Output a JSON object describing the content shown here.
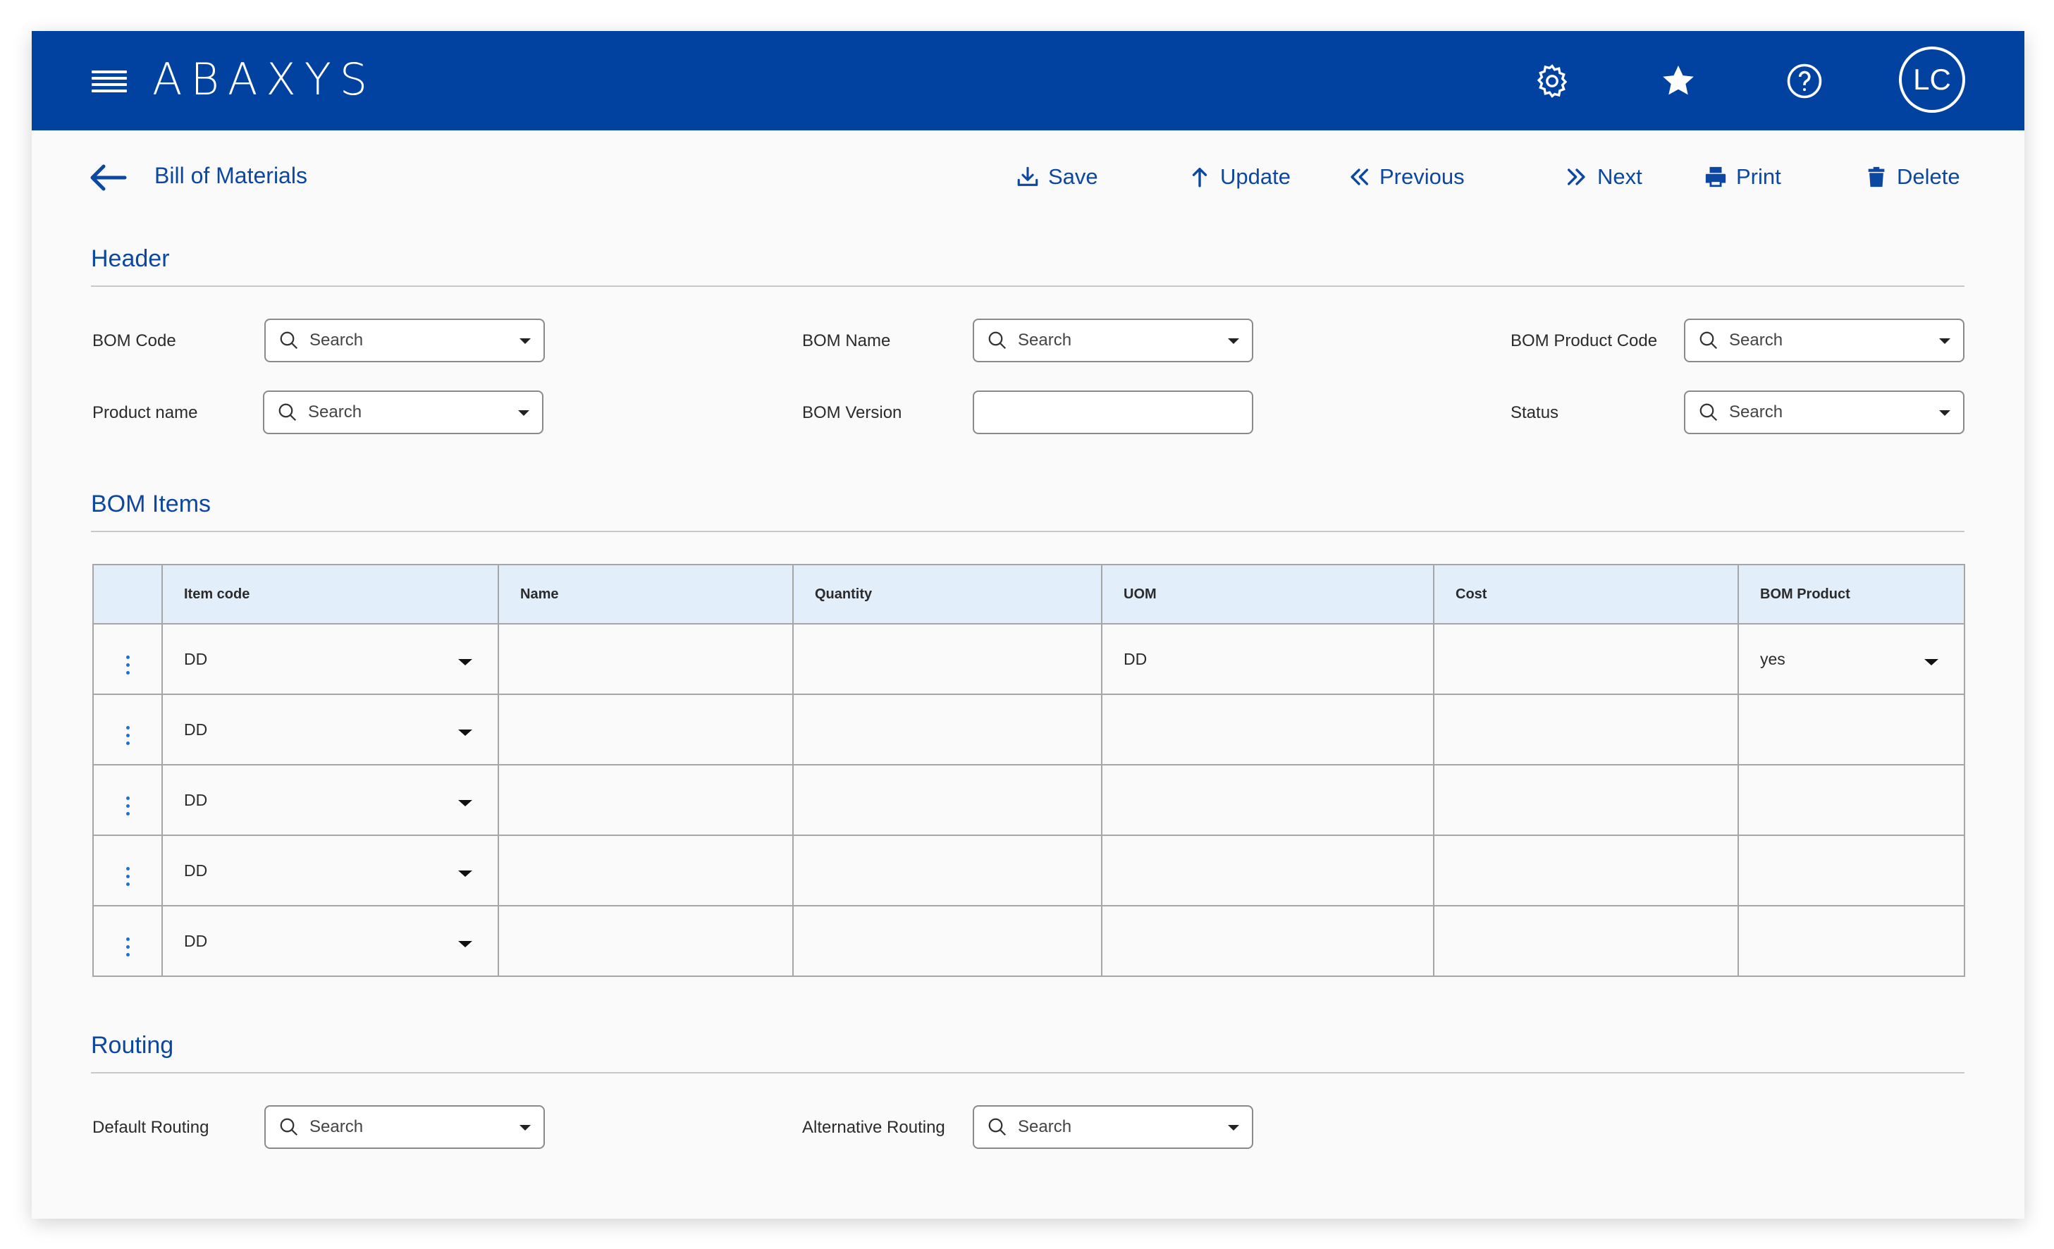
{
  "app": {
    "logo": "ABAXYS",
    "user_initials": "LC"
  },
  "colors": {
    "topbar": "#0141a0",
    "accent_text": "#0c47a1",
    "table_header_bg": "#e3eefb",
    "kebab": "#1f6fd6"
  },
  "icons": {
    "menu": "hamburger-icon",
    "settings": "gear-icon",
    "favorites": "star-icon",
    "help": "help-circle-icon",
    "back": "arrow-left-icon"
  },
  "toolbar": {
    "page_title": "Bill of Materials",
    "save": "Save",
    "update": "Update",
    "previous": "Previous",
    "next": "Next",
    "print": "Print",
    "delete": "Delete"
  },
  "header_section": {
    "title": "Header",
    "bom_code_label": "BOM Code",
    "bom_name_label": "BOM Name",
    "bom_product_code_label": "BOM Product Code",
    "product_name_label": "Product name",
    "bom_version_label": "BOM Version",
    "status_label": "Status",
    "search_placeholder": "Search",
    "bom_version_value": ""
  },
  "bom_items": {
    "title": "BOM Items",
    "columns": [
      "",
      "Item code",
      "Name",
      "Quantity",
      "UOM",
      "Cost",
      "BOM Product"
    ],
    "rows": [
      {
        "item_code": "DD",
        "name": "",
        "quantity": "",
        "uom": "DD",
        "cost": "",
        "bom_product": "yes"
      },
      {
        "item_code": "DD",
        "name": "",
        "quantity": "",
        "uom": "",
        "cost": "",
        "bom_product": ""
      },
      {
        "item_code": "DD",
        "name": "",
        "quantity": "",
        "uom": "",
        "cost": "",
        "bom_product": ""
      },
      {
        "item_code": "DD",
        "name": "",
        "quantity": "",
        "uom": "",
        "cost": "",
        "bom_product": ""
      },
      {
        "item_code": "DD",
        "name": "",
        "quantity": "",
        "uom": "",
        "cost": "",
        "bom_product": ""
      }
    ]
  },
  "routing": {
    "title": "Routing",
    "default_routing_label": "Default Routing",
    "alternative_routing_label": "Alternative Routing",
    "search_placeholder": "Search"
  }
}
